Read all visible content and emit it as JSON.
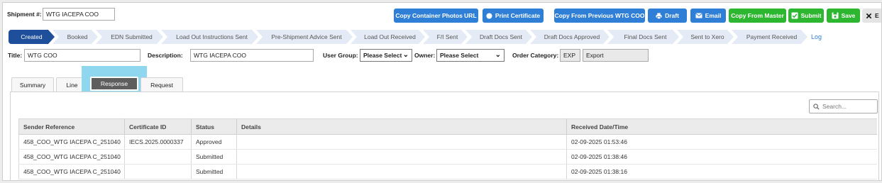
{
  "header": {
    "shipment_label": "Shipment #:",
    "shipment_value": "WTG IACEPA COO"
  },
  "toolbar": {
    "copy_container_photos": "Copy Container Photos URL",
    "print_certificate": "Print Certificate",
    "copy_previous": "Copy From Previous WTG COO",
    "draft": "Draft",
    "email": "Email",
    "copy_master": "Copy From Master",
    "submit": "Submit",
    "save": "Save",
    "exit": "E",
    "colors": {
      "blue": "#2f7fd6",
      "green": "#2db62f",
      "dark_blue": "#1f4f9b"
    }
  },
  "workflow": {
    "steps": [
      "Created",
      "Booked",
      "EDN Submitted",
      "Load Out Instructions Sent",
      "Pre-Shipment Advice Sent",
      "Load Out Received",
      "F/I Sent",
      "Draft Docs Sent",
      "Draft Docs Approved",
      "Final Docs Sent",
      "Sent to Xero",
      "Payment Received"
    ],
    "active": "Created",
    "log_label": "Log"
  },
  "form": {
    "title_label": "Title:",
    "title_value": "WTG COO",
    "description_label": "Description:",
    "description_value": "WTG IACEPA COO",
    "user_group_label": "User Group:",
    "user_group_value": "Please Select",
    "owner_label": "Owner:",
    "owner_value": "Please Select",
    "order_category_label": "Order Category:",
    "order_category_code": "EXP",
    "order_category_value": "Export"
  },
  "tabs": {
    "items": [
      "Summary",
      "Line",
      "Response",
      "Request"
    ],
    "active": "Response"
  },
  "search": {
    "placeholder": "Search..."
  },
  "table": {
    "columns": [
      "Sender Reference",
      "Certificate ID",
      "Status",
      "Details",
      "Received Date/Time"
    ],
    "rows": [
      [
        "458_COO_WTG IACEPA C_251040",
        "IECS.2025.0000337",
        "Approved",
        "",
        "02-09-2025 01:53:46"
      ],
      [
        "458_COO_WTG IACEPA C_251040",
        "",
        "Submitted",
        "",
        "02-09-2025 01:38:46"
      ],
      [
        "458_COO_WTG IACEPA C_251040",
        "",
        "Submitted",
        "",
        "02-09-2025 01:38:16"
      ]
    ]
  }
}
